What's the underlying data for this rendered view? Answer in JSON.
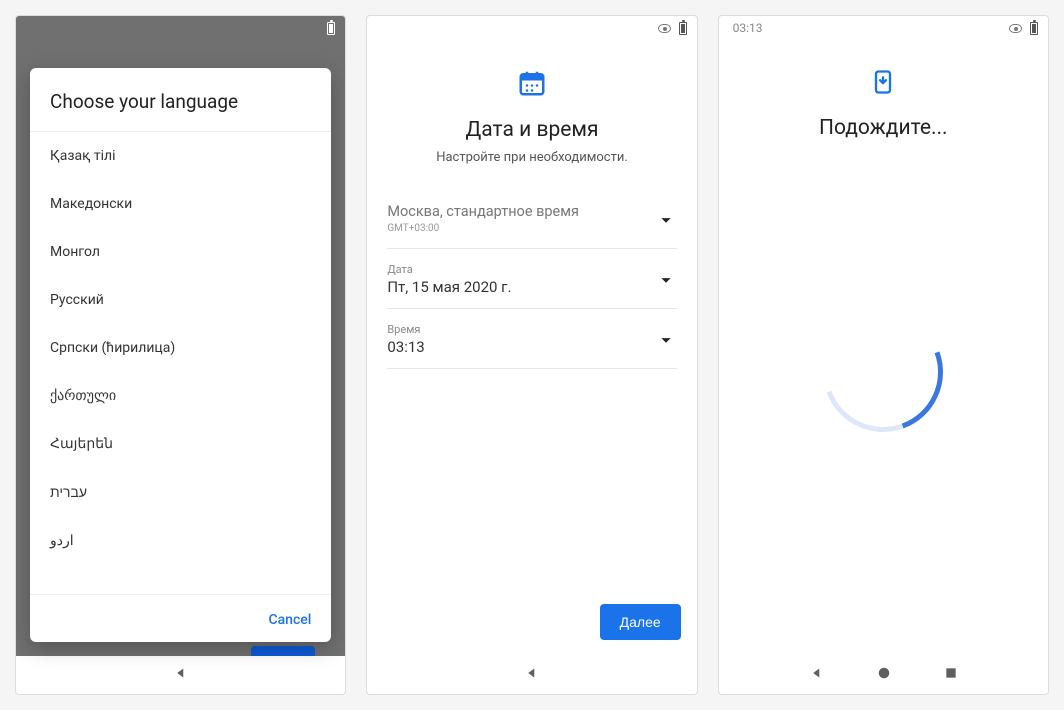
{
  "screen1": {
    "modal_title": "Choose your language",
    "languages": [
      "Қазақ тілі",
      "Македонски",
      "Монгол",
      "Русский",
      "Српски (ћирилица)",
      "ქართული",
      "Հայերեն",
      "עברית",
      "اردو"
    ],
    "cancel": "Cancel"
  },
  "screen2": {
    "title": "Дата и время",
    "subtitle": "Настройте при необходимости.",
    "timezone_name": "Москва, стандартное время",
    "timezone_offset": "GMT+03:00",
    "date_label": "Дата",
    "date_value": "Пт, 15 мая 2020 г.",
    "time_label": "Время",
    "time_value": "03:13",
    "next_button": "Далее"
  },
  "screen3": {
    "status_time": "03:13",
    "title": "Подождите..."
  }
}
